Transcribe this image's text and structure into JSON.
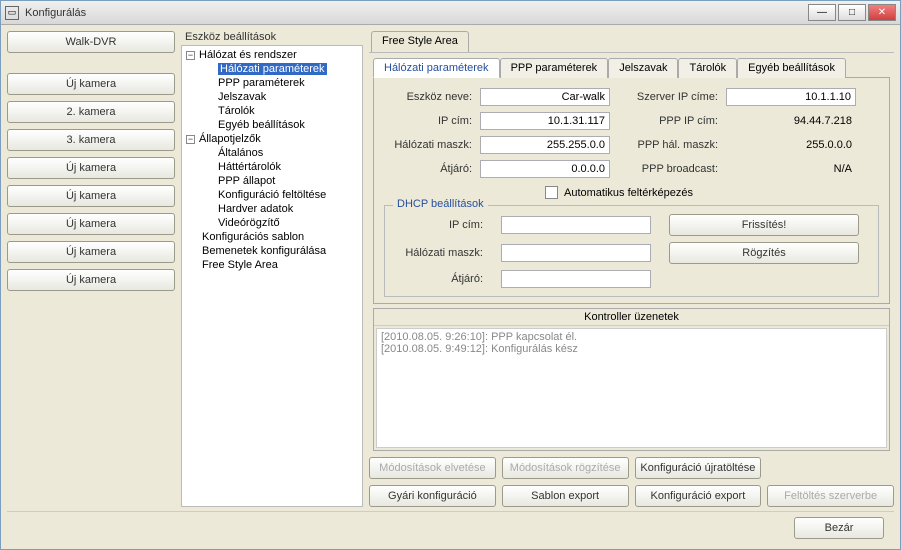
{
  "window": {
    "title": "Konfigurálás"
  },
  "sidebar": {
    "walk": "Walk-DVR",
    "items": [
      "Új kamera",
      "2. kamera",
      "3. kamera",
      "Új kamera",
      "Új kamera",
      "Új kamera",
      "Új kamera",
      "Új kamera"
    ]
  },
  "treePanel": {
    "title": "Eszköz beállítások",
    "nodes": {
      "root1": "Hálózat és rendszer",
      "n_halozati": "Hálózati paraméterek",
      "n_ppp": "PPP paraméterek",
      "n_jelszavak": "Jelszavak",
      "n_tarolok": "Tárolók",
      "n_egyeb": "Egyéb beállítások",
      "root2": "Állapotjelzők",
      "s_alt": "Általános",
      "s_hatter": "Háttértárolók",
      "s_pppstat": "PPP állapot",
      "s_konfup": "Konfiguráció feltöltése",
      "s_hw": "Hardver adatok",
      "s_video": "Videórögzítő",
      "konf_sablon": "Konfigurációs sablon",
      "bemenetek": "Bemenetek konfigurálása",
      "freestyle": "Free Style Area"
    }
  },
  "topTab": {
    "label": "Free Style Area"
  },
  "tabs2": [
    "Hálózati paraméterek",
    "PPP paraméterek",
    "Jelszavak",
    "Tárolók",
    "Egyéb beállítások"
  ],
  "form": {
    "left": [
      {
        "label": "Eszköz neve:",
        "value": "Car-walk"
      },
      {
        "label": "IP cím:",
        "value": "10.1.31.117"
      },
      {
        "label": "Hálózati maszk:",
        "value": "255.255.0.0"
      },
      {
        "label": "Átjáró:",
        "value": "0.0.0.0"
      }
    ],
    "right": [
      {
        "label": "Szerver IP címe:",
        "value": "10.1.1.10"
      },
      {
        "label": "PPP IP cím:",
        "value": "94.44.7.218"
      },
      {
        "label": "PPP hál. maszk:",
        "value": "255.0.0.0"
      },
      {
        "label": "PPP broadcast:",
        "value": "N/A"
      }
    ],
    "auto": "Automatikus feltérképezés"
  },
  "dhcp": {
    "legend": "DHCP beállítások",
    "rows": [
      {
        "label": "IP cím:",
        "btn": "Frissítés!"
      },
      {
        "label": "Hálózati maszk:",
        "btn": "Rögzítés"
      },
      {
        "label": "Átjáró:",
        "btn": ""
      }
    ]
  },
  "log": {
    "title": "Kontroller üzenetek",
    "lines": [
      "[2010.08.05. 9:26:10]: PPP kapcsolat él.",
      "[2010.08.05. 9:49:12]: Konfigurálás kész"
    ]
  },
  "bottom": {
    "r1": [
      "Módosítások elvetése",
      "Módosítások rögzítése",
      "Konfiguráció újratöltése",
      ""
    ],
    "r2": [
      "Gyári konfiguráció",
      "Sablon export",
      "Konfiguráció export",
      "Feltöltés szerverbe"
    ],
    "disabled": [
      0,
      1,
      7
    ]
  },
  "footer": {
    "close": "Bezár"
  }
}
